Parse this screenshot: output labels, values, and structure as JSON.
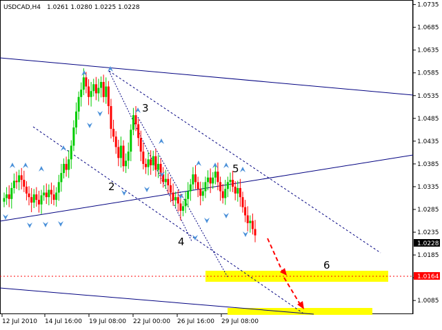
{
  "header": {
    "symbol": "USDCAD,H4",
    "ohlc": "1.0261 1.0280 1.0225 1.0228"
  },
  "colors": {
    "bull": "#00cc00",
    "bear": "#ff0000",
    "channel": "#000080",
    "fractal": "#4a90d9",
    "target_zone": "#ffff00",
    "target_line": "#ff0000",
    "price_tag_bg": "#000000",
    "target_tag_bg": "#ff0000"
  },
  "chart_data": {
    "type": "candlestick",
    "ylim": [
      1.0055,
      1.0745
    ],
    "y_ticks": [
      "1.0735",
      "1.0685",
      "1.0635",
      "1.0585",
      "1.0535",
      "1.0485",
      "1.0435",
      "1.0385",
      "1.0335",
      "1.0285",
      "1.0235",
      "1.0185",
      "1.0135",
      "1.0085"
    ],
    "x_ticks": [
      "12 Jul 2010",
      "14 Jul 16:00",
      "19 Jul 08:00",
      "22 Jul 00:00",
      "26 Jul 16:00",
      "29 Jul 08:00"
    ],
    "current_price": "1.0228",
    "target_price": "1.0164",
    "closes": [
      1.031,
      1.0318,
      1.0308,
      1.0332,
      1.0348,
      1.0345,
      1.036,
      1.035,
      1.0335,
      1.032,
      1.0312,
      1.03,
      1.0318,
      1.0306,
      1.0296,
      1.0316,
      1.0322,
      1.0312,
      1.0328,
      1.0318,
      1.0306,
      1.0322,
      1.0345,
      1.0365,
      1.0385,
      1.0372,
      1.0395,
      1.0425,
      1.0465,
      1.05,
      1.0532,
      1.0548,
      1.0575,
      1.0555,
      1.0532,
      1.0545,
      1.056,
      1.054,
      1.0552,
      1.0565,
      1.0532,
      1.0555,
      1.0512,
      1.0462,
      1.0445,
      1.0422,
      1.0398,
      1.0425,
      1.038,
      1.0392,
      1.0412,
      1.046,
      1.0492,
      1.0472,
      1.0442,
      1.0412,
      1.0385,
      1.0378,
      1.0395,
      1.0382,
      1.0402,
      1.0372,
      1.0385,
      1.0362,
      1.0345,
      1.0352,
      1.0338,
      1.0322,
      1.0305,
      1.0312,
      1.0298,
      1.0282,
      1.0292,
      1.0308,
      1.0325,
      1.034,
      1.0362,
      1.0345,
      1.033,
      1.0315,
      1.0325,
      1.0345,
      1.0355,
      1.0342,
      1.0355,
      1.0368,
      1.0345,
      1.0325,
      1.031,
      1.033,
      1.0345,
      1.035,
      1.0335,
      1.032,
      1.0332,
      1.0312,
      1.029,
      1.0272,
      1.0255,
      1.026,
      1.0242,
      1.0228
    ]
  },
  "annotations": {
    "wave_1": "1",
    "wave_2": "2",
    "wave_3": "3",
    "wave_4": "4",
    "wave_5": "5",
    "wave_6": "6"
  }
}
